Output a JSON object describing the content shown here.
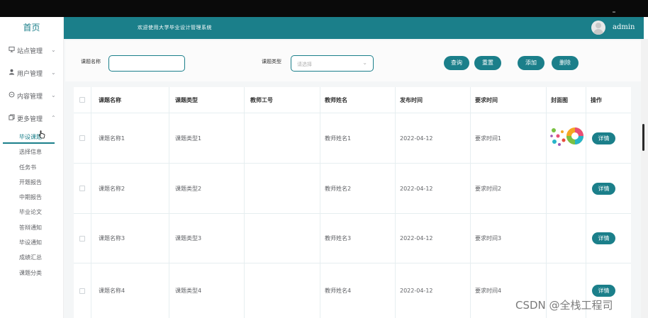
{
  "app": {
    "header_title": "欢迎使用大学毕业设计管理系统",
    "username": "admin"
  },
  "sidebar": {
    "home": "首页",
    "groups": [
      {
        "label": "站点管理",
        "icon": "monitor-icon"
      },
      {
        "label": "用户管理",
        "icon": "user-icon"
      },
      {
        "label": "内容管理",
        "icon": "chat-icon"
      },
      {
        "label": "更多管理",
        "icon": "copy-icon"
      }
    ],
    "sub_items": [
      "毕设课题",
      "选择信息",
      "任务书",
      "开题报告",
      "中期报告",
      "毕业论文",
      "答辩通知",
      "毕设通知",
      "成绩汇总",
      "课题分类"
    ]
  },
  "search": {
    "name_label": "课题名称",
    "name_value": "",
    "type_label": "课题类型",
    "type_placeholder": "请选择",
    "query_button": "查询",
    "reset_button": "重置",
    "add_button": "添加",
    "delete_button": "删除"
  },
  "table": {
    "columns": [
      "课题名称",
      "课题类型",
      "教师工号",
      "教师姓名",
      "发布时间",
      "要求时间",
      "封面图",
      "操作"
    ],
    "rows": [
      {
        "name": "课题名称1",
        "type": "课题类型1",
        "teacher_id": "",
        "teacher_name": "教师姓名1",
        "publish": "2022-04-12",
        "required": "要求时间1",
        "has_cover": true,
        "action": "详情"
      },
      {
        "name": "课题名称2",
        "type": "课题类型2",
        "teacher_id": "",
        "teacher_name": "教师姓名2",
        "publish": "2022-04-12",
        "required": "要求时间2",
        "has_cover": false,
        "action": "详情"
      },
      {
        "name": "课题名称3",
        "type": "课题类型3",
        "teacher_id": "",
        "teacher_name": "教师姓名3",
        "publish": "2022-04-12",
        "required": "要求时间3",
        "has_cover": false,
        "action": "详情"
      },
      {
        "name": "课题名称4",
        "type": "课题类型4",
        "teacher_id": "",
        "teacher_name": "教师姓名4",
        "publish": "2022-04-12",
        "required": "要求时间4",
        "has_cover": false,
        "action": "详情"
      }
    ]
  },
  "watermark": "CSDN @全栈工程司",
  "colors": {
    "primary": "#1b7f8a",
    "background": "#f4f6f7"
  }
}
